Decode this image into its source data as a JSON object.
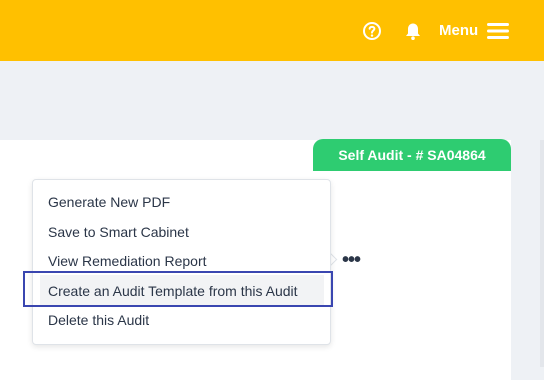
{
  "header": {
    "menu_label": "Menu",
    "icons": [
      "help-icon",
      "bell-icon",
      "hamburger-icon"
    ],
    "background": "#ffc000"
  },
  "badge": {
    "text": "Self Audit - # SA04864",
    "color": "#2ecc71"
  },
  "actions": {
    "more_label": "•••",
    "items": [
      "Generate New PDF",
      "Save to Smart Cabinet",
      "View Remediation Report",
      "Create an Audit Template from this Audit",
      "Delete this Audit"
    ],
    "highlighted_item_color": "#3a46b0"
  }
}
